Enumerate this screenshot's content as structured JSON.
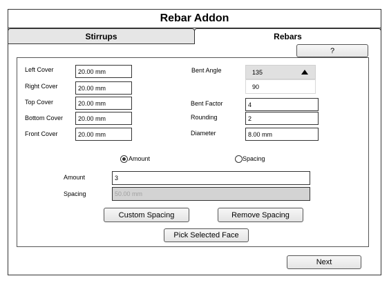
{
  "window": {
    "title": "Rebar Addon"
  },
  "tabs": [
    {
      "label": "Stirrups",
      "active": false
    },
    {
      "label": "Rebars",
      "active": true
    }
  ],
  "help_button": "?",
  "covers": {
    "left": {
      "label": "Left Cover",
      "value": "20.00 mm"
    },
    "right": {
      "label": "Right Cover",
      "value": "20.00 mm"
    },
    "top": {
      "label": "Top Cover",
      "value": "20.00 mm"
    },
    "bottom": {
      "label": "Bottom Cover",
      "value": "20.00 mm"
    },
    "front": {
      "label": "Front Cover",
      "value": "20.00 mm"
    }
  },
  "bent_angle": {
    "label": "Bent Angle",
    "selected": "135",
    "options": [
      "90"
    ]
  },
  "bent_factor": {
    "label": "Bent Factor",
    "value": "4"
  },
  "rounding": {
    "label": "Rounding",
    "value": "2"
  },
  "diameter": {
    "label": "Diameter",
    "value": "8.00 mm"
  },
  "mode": {
    "amount_option": "Amount",
    "spacing_option": "Spacing",
    "selected": "Amount"
  },
  "amount": {
    "label": "Amount",
    "value": "3"
  },
  "spacing": {
    "label": "Spacing",
    "value": "50.00 mm",
    "disabled": true
  },
  "buttons": {
    "custom_spacing": "Custom Spacing",
    "remove_spacing": "Remove Spacing",
    "pick_selected_face": "Pick Selected Face",
    "next": "Next"
  }
}
